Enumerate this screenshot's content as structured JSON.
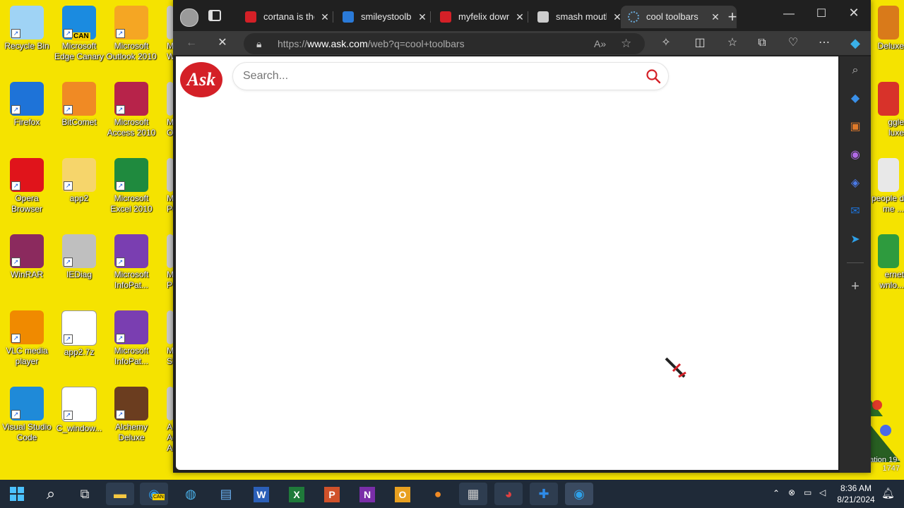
{
  "desktop": {
    "icons_left": [
      {
        "label": "Recycle Bin",
        "icon": "recycle-bin-icon",
        "color": "#9fd3f5"
      },
      {
        "label": "Microsoft Edge Canary",
        "icon": "edge-canary-icon",
        "color": "#1b8be0",
        "badge": "CAN"
      },
      {
        "label": "Microsoft Outlook 2010",
        "icon": "outlook-icon",
        "color": "#f5a623"
      },
      {
        "label": "Firefox",
        "icon": "firefox-icon",
        "color": "#1e73d8"
      },
      {
        "label": "BitComet",
        "icon": "bitcomet-icon",
        "color": "#f08a24"
      },
      {
        "label": "Microsoft Access 2010",
        "icon": "access-icon",
        "color": "#b7234a"
      },
      {
        "label": "Opera Browser",
        "icon": "opera-icon",
        "color": "#e0141b"
      },
      {
        "label": "app2",
        "icon": "folder-icon",
        "color": "#f6d56b"
      },
      {
        "label": "Microsoft Excel 2010",
        "icon": "excel-icon",
        "color": "#1f8a3e"
      },
      {
        "label": "WinRAR",
        "icon": "winrar-icon",
        "color": "#8b2a5e"
      },
      {
        "label": "IEDiag",
        "icon": "iediag-icon",
        "color": "#bfbfbf"
      },
      {
        "label": "Microsoft InfoPat...",
        "icon": "infopath-icon",
        "color": "#7a3eb1"
      },
      {
        "label": "VLC media player",
        "icon": "vlc-icon",
        "color": "#f08a00"
      },
      {
        "label": "app2.7z",
        "icon": "file-icon",
        "color": "#ffffff"
      },
      {
        "label": "Microsoft InfoPat...",
        "icon": "infopath-icon",
        "color": "#7a3eb1"
      },
      {
        "label": "Visual Studio Code",
        "icon": "vscode-icon",
        "color": "#1f8ad8"
      },
      {
        "label": "C_window...",
        "icon": "file-icon",
        "color": "#ffffff"
      },
      {
        "label": "Alchemy Deluxe",
        "icon": "alchemy-icon",
        "color": "#6b3d1f"
      }
    ],
    "partial_col4": [
      "M W",
      "M O",
      "M Po",
      "M P",
      "M Sh",
      "A Ac Ar"
    ],
    "icons_right": [
      {
        "label": "Deluxe",
        "icon": "game-icon",
        "color": "#d97a1a"
      },
      {
        "label": "ggle luxe",
        "icon": "game-icon",
        "color": "#d8322a"
      },
      {
        "label": "people d me ...",
        "icon": "people-icon",
        "color": "#e8e8e8"
      },
      {
        "label": "ernet wnlo...",
        "icon": "download-icon",
        "color": "#2e9b3e"
      }
    ],
    "tree_caption": "ation 19-1747"
  },
  "browser": {
    "tabs": [
      {
        "title": "cortana is the",
        "favicon": "ask-favicon",
        "color": "#d42027",
        "active": false
      },
      {
        "title": "smileystoolba",
        "favicon": "smiley-favicon",
        "color": "#2a7ad8",
        "active": false
      },
      {
        "title": "myfelix down",
        "favicon": "ask-favicon",
        "color": "#d42027",
        "active": false
      },
      {
        "title": "smash mouth",
        "favicon": "page-favicon",
        "color": "#cccccc",
        "active": false
      },
      {
        "title": "cool toolbars",
        "favicon": "loading-favicon",
        "color": "#6aa9d8",
        "active": true
      }
    ],
    "url_prefix": "https://",
    "url_domain": "www.ask.com",
    "url_path": "/web?q=cool+toolbars",
    "search_placeholder": "Search...",
    "logo_text": "Ask",
    "accent": "#d42027"
  },
  "taskbar": {
    "time": "8:36 AM",
    "date": "8/21/2024",
    "canary_badge": "CAN"
  }
}
